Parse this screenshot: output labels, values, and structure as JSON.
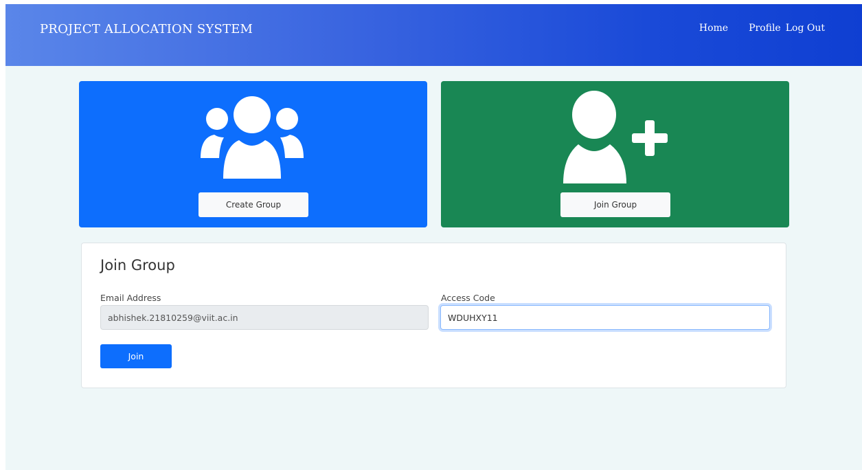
{
  "navbar": {
    "brand": "PROJECT ALLOCATION SYSTEM",
    "links": [
      {
        "label": "Home"
      },
      {
        "label": "Profile"
      },
      {
        "label": "Log Out"
      }
    ]
  },
  "cards": {
    "create": {
      "button_label": "Create Group",
      "icon": "users-group-icon",
      "color": "#0d6efd"
    },
    "join": {
      "button_label": "Join Group",
      "icon": "user-plus-icon",
      "color": "#198754"
    }
  },
  "join_form": {
    "title": "Join Group",
    "email": {
      "label": "Email Address",
      "value": "abhishek.21810259@viit.ac.in"
    },
    "access_code": {
      "label": "Access Code",
      "value": "WDUHXY11"
    },
    "submit_label": "Join"
  },
  "colors": {
    "primary": "#0d6efd",
    "success": "#198754",
    "navbar_gradient_start": "#5a86e9",
    "navbar_gradient_end": "#0f3fd2"
  }
}
